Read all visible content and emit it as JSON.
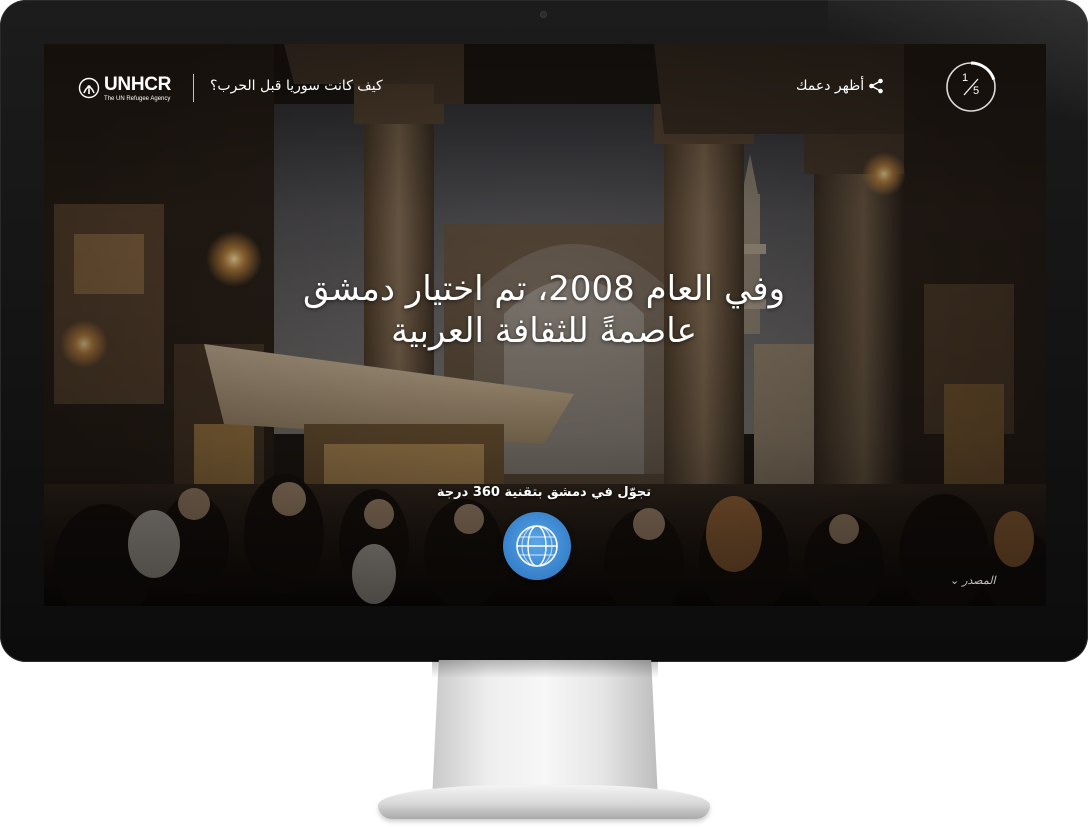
{
  "header": {
    "logo_name": "UNHCR",
    "logo_tagline": "The UN Refugee Agency",
    "story_title": "كيف كانت سوريا قبل الحرب؟",
    "share_label": "أظهر دعمك",
    "progress": {
      "current": "1",
      "total": "5",
      "fraction": 0.2
    }
  },
  "main": {
    "headline_line1": "وفي العام 2008، تم اختيار دمشق",
    "headline_line2": "عاصمةً للثقافة العربية",
    "cta_label": "تجوّل في دمشق بتقنية 360 درجة",
    "cta_icon": "360-globe-icon"
  },
  "footer": {
    "source_label": "المصدر",
    "source_icon": "chevron-down-icon"
  },
  "colors": {
    "accent_button": "#3b86cf",
    "text": "#ffffff",
    "bezel": "#111111"
  }
}
